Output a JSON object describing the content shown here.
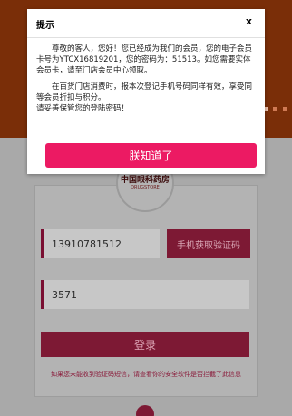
{
  "background": {
    "logo": {
      "text": "中国眼科药房",
      "subtext": "DRUGSTORE"
    },
    "login_form": {
      "phone_value": "13910781512",
      "sms_button_label": "手机获取验证码",
      "code_value": "3571",
      "login_button_label": "登录",
      "notice": "如果您未能收到验证码短信，请查看你的安全软件是否拦截了此信息"
    }
  },
  "dialog": {
    "title": "提示",
    "close_label": "x",
    "paragraph1": "尊敬的客人，您好！您已经成为我们的会员，您的电子会员卡号为YTCX16819201，您的密码为：51513。如您需要实体会员卡，请至门店会员中心领取。",
    "paragraph2": "在百货门店消费时，报本次登记手机号码同样有效，享受同等会员折扣与积分。",
    "paragraph3": "请妥善保管您的登陆密码！",
    "ok_button_label": "朕知道了"
  },
  "colors": {
    "header_brown": "#7a2e08",
    "accent_pink": "#ec1a63",
    "dim_maroon": "#7d1934"
  }
}
